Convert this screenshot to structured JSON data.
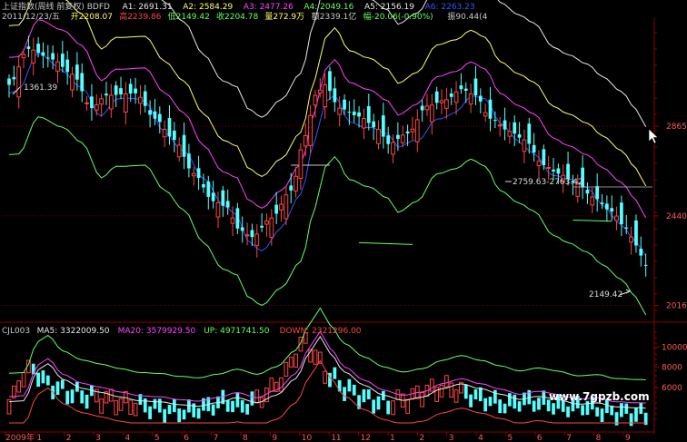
{
  "header": {
    "line1": [
      {
        "text": "上证指数(周线 前复权) BDFD",
        "color": "#c8c8c8"
      },
      {
        "text": "A1: 2691.31",
        "color": "#e8e8e8"
      },
      {
        "text": "A2: 2584.29",
        "color": "#ffff66"
      },
      {
        "text": "A3: 2477.26",
        "color": "#ff44ff"
      },
      {
        "text": "A4: 2049.16",
        "color": "#66ff66"
      },
      {
        "text": "A5: 2156.19",
        "color": "#e8e8e8"
      },
      {
        "text": "A6: 2263.23",
        "color": "#3355ff"
      }
    ],
    "line2": [
      {
        "text": "2011/12/23/五",
        "color": "#c8c8c8"
      },
      {
        "text": "开2208.07",
        "color": "#ffff66"
      },
      {
        "text": "高2239.86",
        "color": "#ff4444"
      },
      {
        "text": "低2149.42",
        "color": "#66ff66"
      },
      {
        "text": "收2204.78",
        "color": "#66ff66"
      },
      {
        "text": "量272.9万",
        "color": "#ffff66"
      },
      {
        "text": "额2339.1亿",
        "color": "#c8c8c8"
      },
      {
        "text": "幅-20.06(-0.90%)",
        "color": "#66ff66"
      },
      {
        "text": "振90.44(4",
        "color": "#c8c8c8"
      }
    ]
  },
  "indicator_header": [
    {
      "text": "CJL003",
      "color": "#c8c8c8"
    },
    {
      "text": "MA5: 3322009.50",
      "color": "#e8e8e8"
    },
    {
      "text": "MA20: 3579929.50",
      "color": "#ff44ff"
    },
    {
      "text": "UP: 4971741.50",
      "color": "#66ff66"
    },
    {
      "text": "DOWN: 2321296.00",
      "color": "#ff4444"
    }
  ],
  "annotations": {
    "high_label": "1361.39",
    "range_label": "2759.63-2763.42",
    "low_label": "2149.42"
  },
  "watermark": "www.7gpzb.com",
  "colors": {
    "up": "#ff4444",
    "down": "#55ffff",
    "grid": "#8b0000",
    "band_white": "#e8e8e8",
    "band_yellow": "#ffff66",
    "band_magenta": "#ff44ff",
    "band_green": "#66ff66",
    "band_blue": "#3355ff"
  },
  "chart_data": [
    {
      "type": "candlestick",
      "title": "上证指数(周线 前复权) BDFD",
      "y_ticks": [
        2865,
        2440,
        2016
      ],
      "ylim": [
        1950,
        3350
      ],
      "x_tick_labels": [
        "2009年",
        "1",
        "2",
        "3",
        "4",
        "5",
        "6",
        "7",
        "8",
        "9",
        "10",
        "11",
        "12",
        "1",
        "2",
        "3",
        "4",
        "5",
        "6",
        "7",
        "8",
        "9"
      ],
      "close_path": [
        [
          0,
          3060
        ],
        [
          4,
          3230
        ],
        [
          9,
          3180
        ],
        [
          13,
          3110
        ],
        [
          17,
          2950
        ],
        [
          20,
          3010
        ],
        [
          26,
          3020
        ],
        [
          30,
          2900
        ],
        [
          34,
          2800
        ],
        [
          38,
          2640
        ],
        [
          42,
          2510
        ],
        [
          45,
          2480
        ],
        [
          47,
          2380
        ],
        [
          50,
          2340
        ],
        [
          54,
          2430
        ],
        [
          58,
          2560
        ],
        [
          61,
          2820
        ],
        [
          63,
          3010
        ],
        [
          65,
          3060
        ],
        [
          68,
          2950
        ],
        [
          72,
          2910
        ],
        [
          76,
          2850
        ],
        [
          78,
          2780
        ],
        [
          82,
          2830
        ],
        [
          86,
          2960
        ],
        [
          90,
          2990
        ],
        [
          93,
          3040
        ],
        [
          96,
          3010
        ],
        [
          99,
          2900
        ],
        [
          103,
          2840
        ],
        [
          106,
          2800
        ],
        [
          110,
          2680
        ],
        [
          113,
          2640
        ],
        [
          117,
          2590
        ],
        [
          120,
          2530
        ],
        [
          124,
          2460
        ],
        [
          127,
          2380
        ],
        [
          129,
          2300
        ],
        [
          131,
          2204.78
        ]
      ],
      "bands": [
        {
          "name": "A1",
          "color": "#e8e8e8",
          "offset": 560
        },
        {
          "name": "A2",
          "color": "#ffff66",
          "offset": 280
        },
        {
          "name": "A3",
          "color": "#ff44ff",
          "offset": 130
        },
        {
          "name": "A6",
          "color": "#3355ff",
          "offset": -40
        },
        {
          "name": "A4",
          "color": "#66ff66",
          "offset": -330
        }
      ],
      "levels": [
        {
          "label": "A5: 2156.19",
          "value": 2156.19
        }
      ]
    },
    {
      "type": "bar",
      "title": "CJL003",
      "y_ticks": [
        10000,
        8000,
        6000
      ],
      "ylim": [
        2500,
        12000
      ],
      "units": "万",
      "volume_path": [
        [
          0,
          4800
        ],
        [
          3,
          7800
        ],
        [
          5,
          8400
        ],
        [
          8,
          6900
        ],
        [
          12,
          6100
        ],
        [
          16,
          5800
        ],
        [
          20,
          5400
        ],
        [
          24,
          5000
        ],
        [
          28,
          4800
        ],
        [
          32,
          4400
        ],
        [
          36,
          4200
        ],
        [
          40,
          4600
        ],
        [
          44,
          5200
        ],
        [
          48,
          4800
        ],
        [
          52,
          5600
        ],
        [
          56,
          7200
        ],
        [
          59,
          9800
        ],
        [
          61,
          11200
        ],
        [
          63,
          9500
        ],
        [
          66,
          7600
        ],
        [
          70,
          6300
        ],
        [
          74,
          5400
        ],
        [
          78,
          5000
        ],
        [
          82,
          5400
        ],
        [
          86,
          6200
        ],
        [
          90,
          6600
        ],
        [
          94,
          6000
        ],
        [
          98,
          5400
        ],
        [
          102,
          4900
        ],
        [
          106,
          5300
        ],
        [
          110,
          5100
        ],
        [
          114,
          4700
        ],
        [
          118,
          4800
        ],
        [
          122,
          4300
        ],
        [
          126,
          4100
        ],
        [
          131,
          3900
        ]
      ],
      "series": [
        {
          "name": "MA5",
          "value": 3322009.5,
          "color": "#e8e8e8"
        },
        {
          "name": "MA20",
          "value": 3579929.5,
          "color": "#ff44ff"
        },
        {
          "name": "UP",
          "value": 4971741.5,
          "color": "#66ff66"
        },
        {
          "name": "DOWN",
          "value": 2321296.0,
          "color": "#ff4444"
        }
      ]
    }
  ]
}
